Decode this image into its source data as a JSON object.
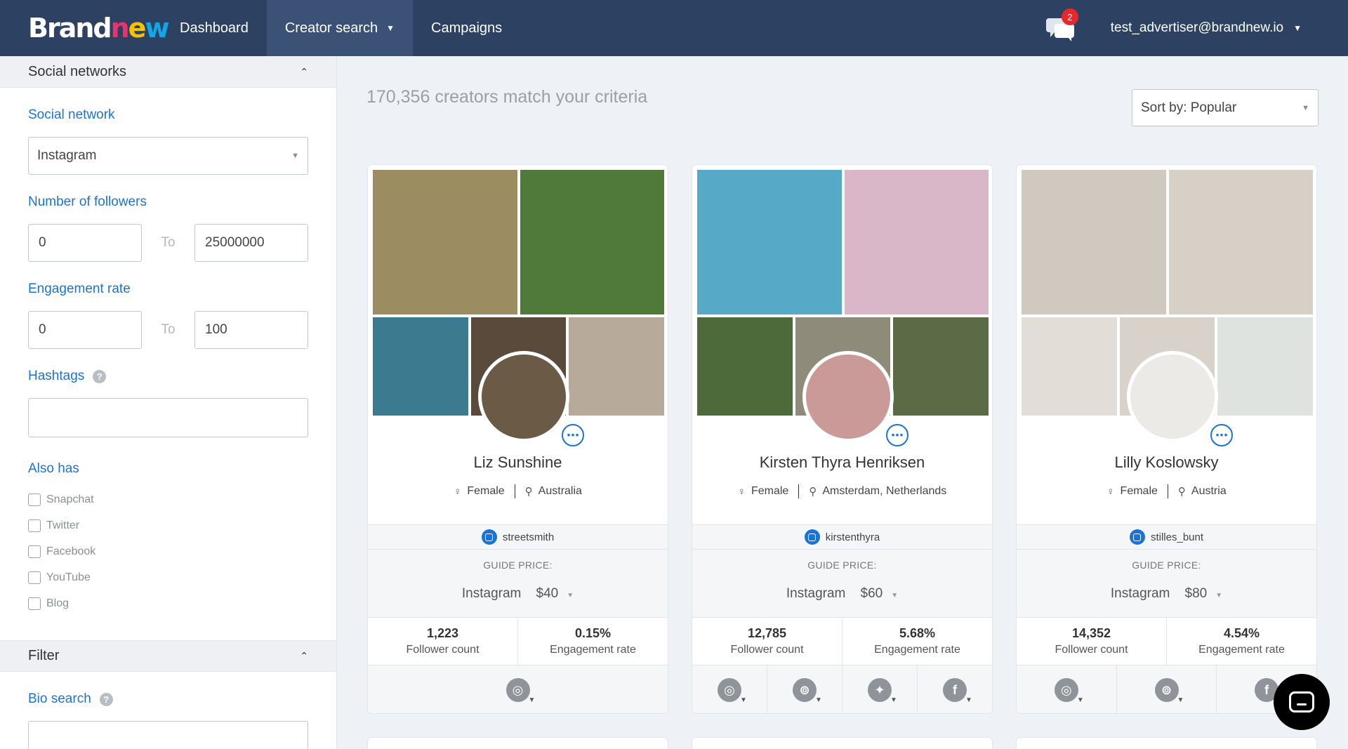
{
  "header": {
    "logo": "Brandnew",
    "nav": [
      {
        "label": "Dashboard"
      },
      {
        "label": "Creator search"
      },
      {
        "label": "Campaigns"
      }
    ],
    "notifications_count": "2",
    "user_email": "test_advertiser@brandnew.io"
  },
  "sidebar": {
    "social_section_title": "Social networks",
    "social_network_label": "Social network",
    "social_network_value": "Instagram",
    "followers_label": "Number of followers",
    "followers_min": "0",
    "followers_max": "25000000",
    "range_to": "To",
    "engagement_label": "Engagement rate",
    "engagement_min": "0",
    "engagement_max": "100",
    "hashtags_label": "Hashtags",
    "also_has_label": "Also has",
    "also_has": [
      "Snapchat",
      "Twitter",
      "Facebook",
      "YouTube",
      "Blog"
    ],
    "filter_section_title": "Filter",
    "bio_search_label": "Bio search",
    "help_glyph": "?"
  },
  "main": {
    "results_count_text": "170,356 creators match your criteria",
    "sort_label": "Sort by: Popular",
    "guide_price_label": "GUIDE PRICE:",
    "follower_count_label": "Follower count",
    "engagement_rate_label": "Engagement rate",
    "cards": [
      {
        "name": "Liz Sunshine",
        "gender": "Female",
        "location": "Australia",
        "handle": "streetsmith",
        "price_network": "Instagram",
        "price": "$40",
        "followers": "1,223",
        "engagement": "0.15%",
        "socials": [
          "instagram-icon"
        ],
        "photo_colors": [
          "#9b8c62",
          "#4f7a3a",
          "#3c7a8f",
          "#5a4a3c",
          "#b7aa9a"
        ],
        "avatar_color": "#6b5a45"
      },
      {
        "name": "Kirsten Thyra Henriksen",
        "gender": "Female",
        "location": "Amsterdam, Netherlands",
        "handle": "kirstenthyra",
        "price_network": "Instagram",
        "price": "$60",
        "followers": "12,785",
        "engagement": "5.68%",
        "socials": [
          "instagram-icon",
          "rss-icon",
          "twitter-icon",
          "facebook-icon"
        ],
        "photo_colors": [
          "#56a9c7",
          "#d9b6c8",
          "#4c6a3a",
          "#8f8b7a",
          "#5b6b45"
        ],
        "avatar_color": "#c99a98"
      },
      {
        "name": "Lilly Koslowsky",
        "gender": "Female",
        "location": "Austria",
        "handle": "stilles_bunt",
        "price_network": "Instagram",
        "price": "$80",
        "followers": "14,352",
        "engagement": "4.54%",
        "socials": [
          "instagram-icon",
          "rss-icon",
          "facebook-icon"
        ],
        "photo_colors": [
          "#cfc9c0",
          "#d6d0c7",
          "#e2ddd6",
          "#d8d2ca",
          "#dfe3e0"
        ],
        "avatar_color": "#eceae6"
      }
    ]
  },
  "colors": {
    "nav_bg": "#2d4163",
    "accent": "#1a73d9",
    "badge": "#e8262d"
  }
}
